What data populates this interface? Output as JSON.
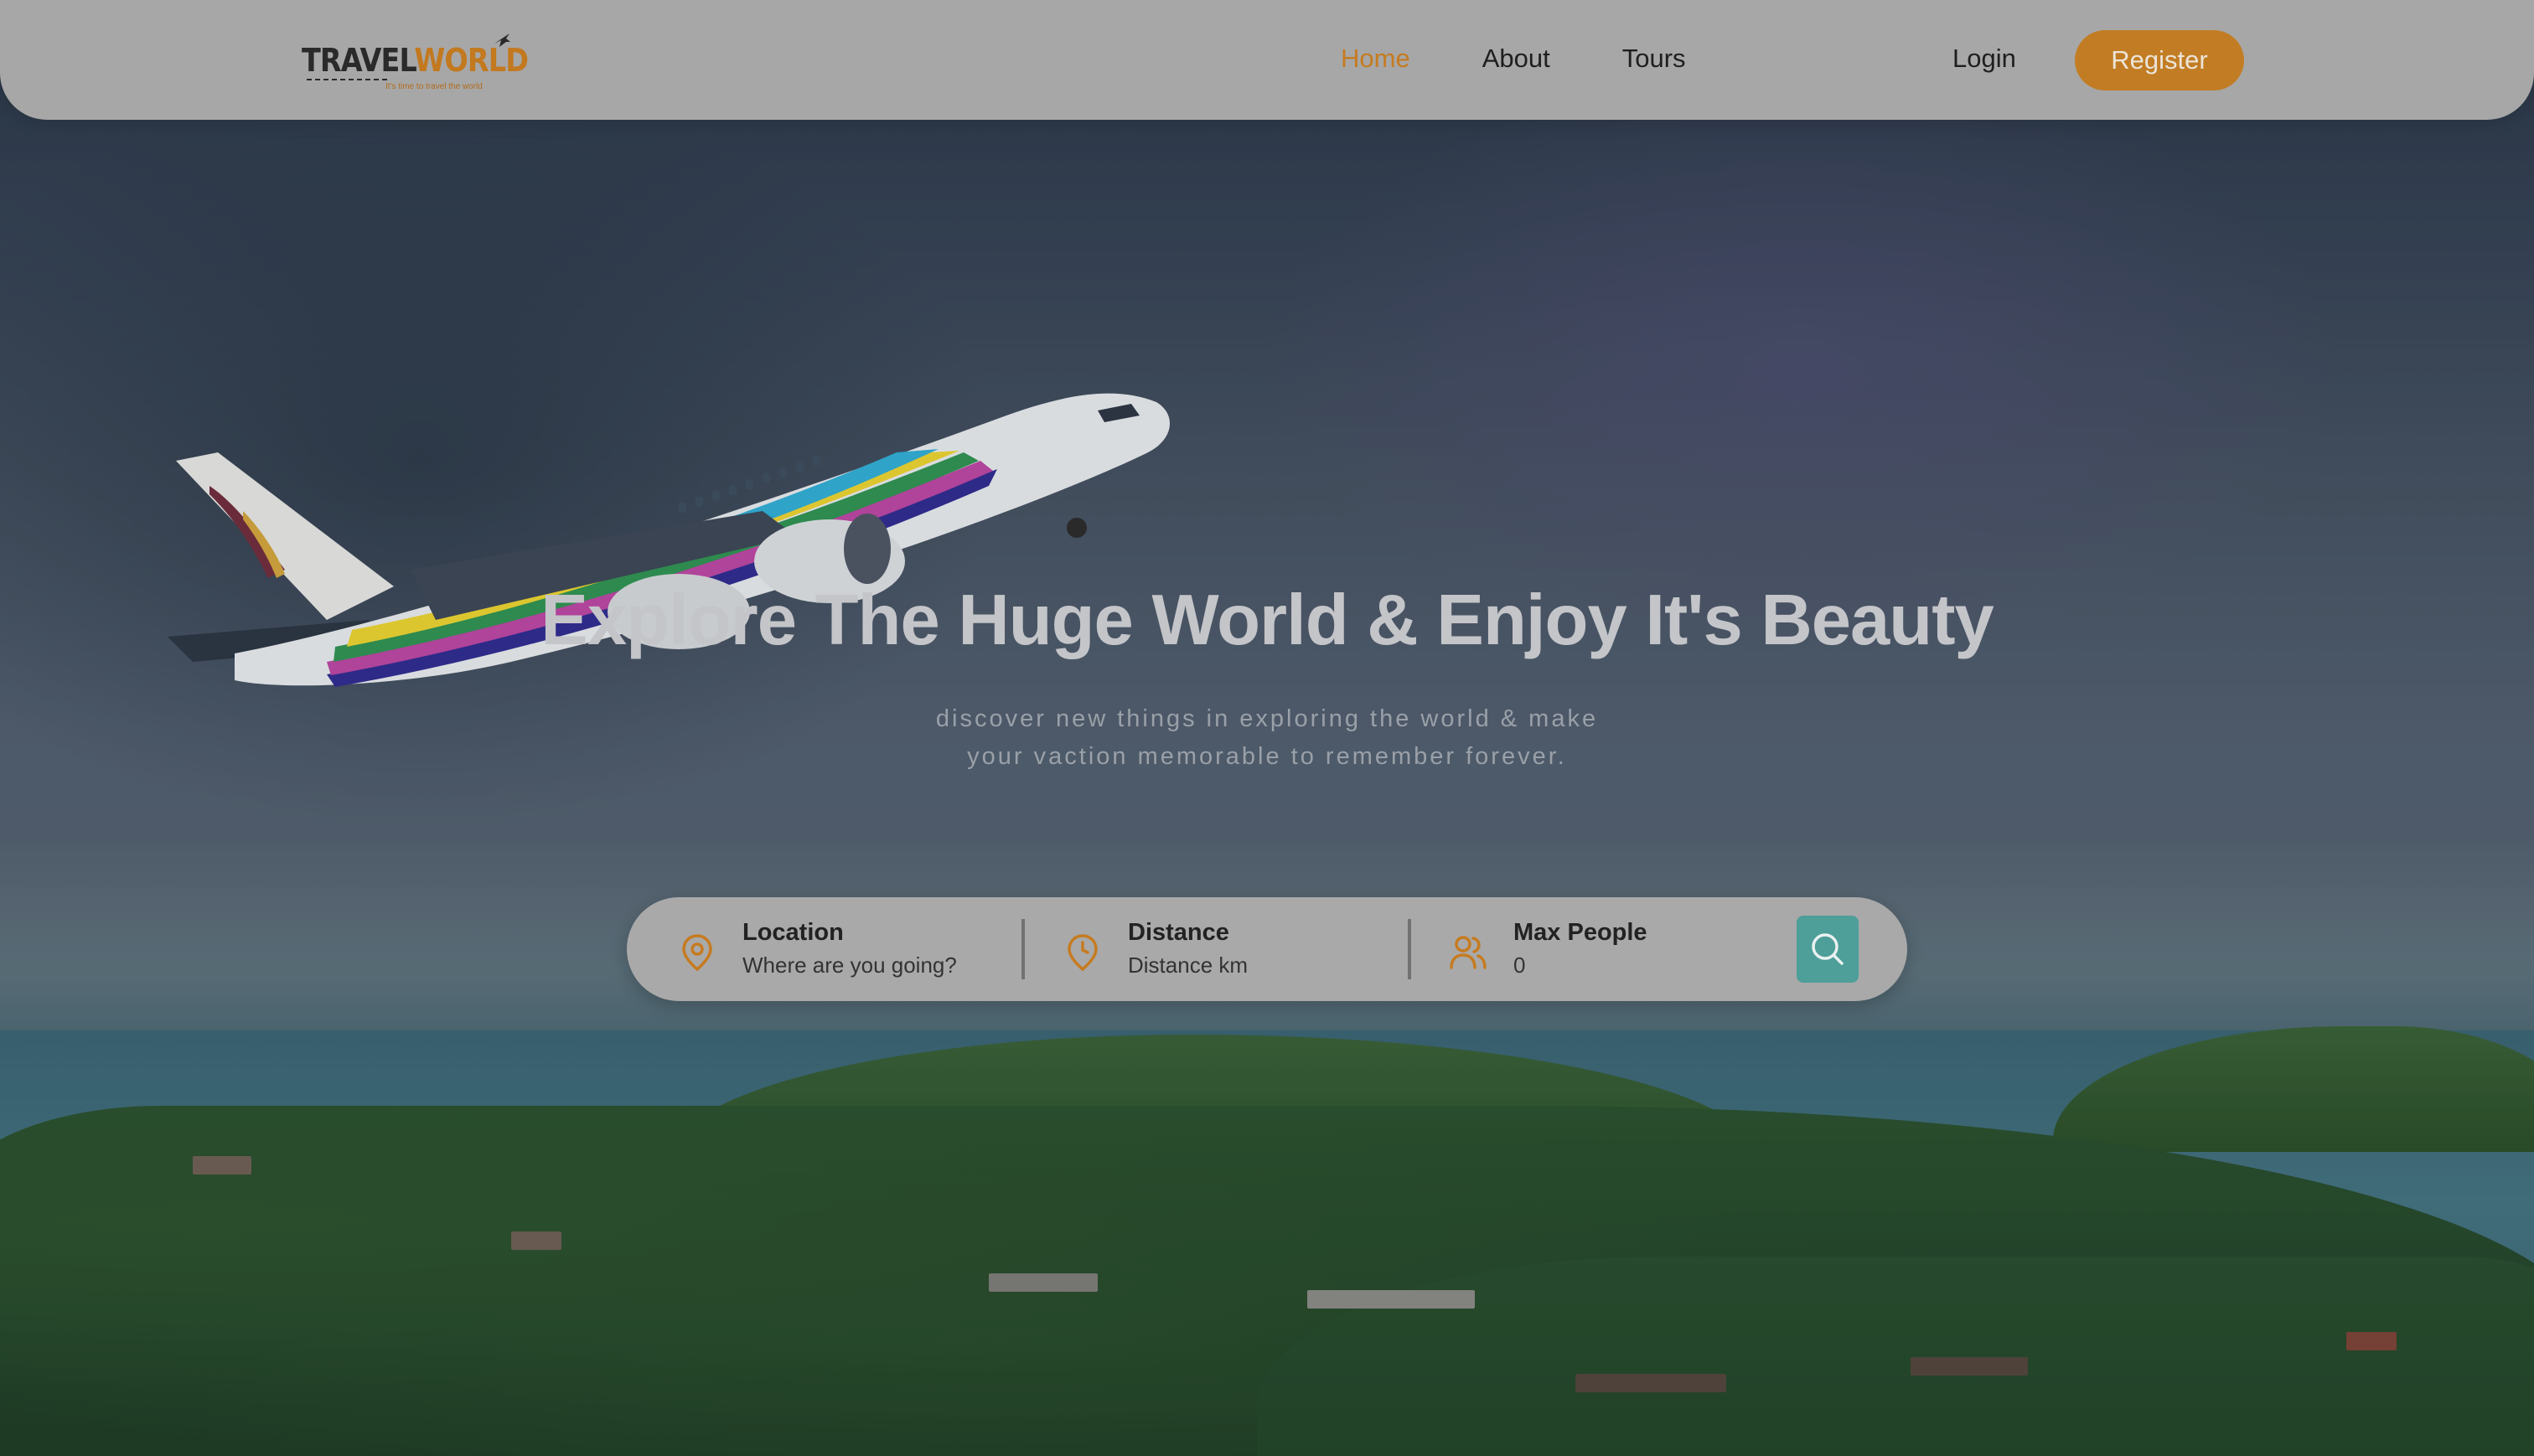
{
  "navbar": {
    "logo": {
      "text_dark": "TRAVEL",
      "text_accent": "WORLD",
      "tagline": "It's time to travel the world"
    },
    "links": [
      {
        "label": "Home",
        "active": true
      },
      {
        "label": "About",
        "active": false
      },
      {
        "label": "Tours",
        "active": false
      }
    ],
    "login_label": "Login",
    "register_label": "Register"
  },
  "hero": {
    "headline": "Explore The Huge World & Enjoy It's Beauty",
    "subtitle_line1": "discover new things in exploring the world & make",
    "subtitle_line2": "your vaction memorable to remember forever."
  },
  "search": {
    "location": {
      "label": "Location",
      "placeholder": "Where are you going?",
      "icon": "map-pin-icon"
    },
    "distance": {
      "label": "Distance",
      "placeholder": "Distance km",
      "icon": "clock-icon"
    },
    "max_people": {
      "label": "Max People",
      "value": "0",
      "icon": "users-icon"
    },
    "button_icon": "search-icon"
  },
  "colors": {
    "accent": "#c67b20",
    "navbar_bg": "#a7a7a7",
    "search_button": "#4e9e99"
  }
}
